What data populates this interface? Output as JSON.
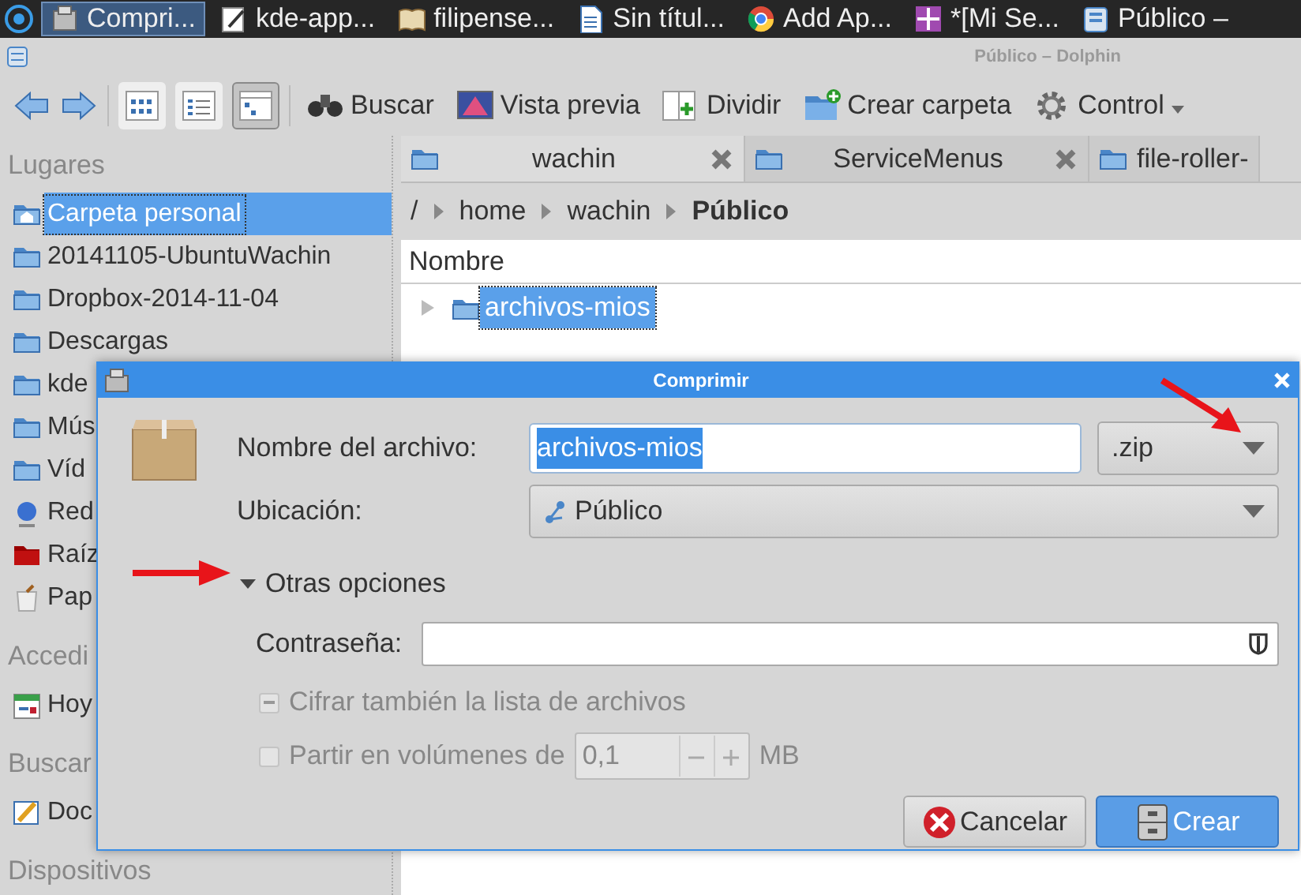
{
  "taskbar": {
    "items": [
      {
        "label": "Compri...",
        "kind": "archive",
        "selected": true
      },
      {
        "label": "kde-app...",
        "kind": "edit",
        "selected": false
      },
      {
        "label": "filipense...",
        "kind": "book",
        "selected": false
      },
      {
        "label": "Sin títul...",
        "kind": "document",
        "selected": false
      },
      {
        "label": "Add  Ap...",
        "kind": "browser",
        "selected": false
      },
      {
        "label": "*[Mi Se...",
        "kind": "image",
        "selected": false
      },
      {
        "label": "Público –",
        "kind": "files",
        "selected": false
      }
    ]
  },
  "window": {
    "title": "Público – Dolphin"
  },
  "toolbar": {
    "view_modes": [
      {
        "kind": "icons",
        "selected": false
      },
      {
        "kind": "compact",
        "selected": false
      },
      {
        "kind": "details",
        "selected": true
      }
    ],
    "actions": [
      {
        "label": "Buscar",
        "kind": "binoculars",
        "menu": false
      },
      {
        "label": "Vista previa",
        "kind": "preview",
        "menu": false
      },
      {
        "label": "Dividir",
        "kind": "split",
        "menu": false
      },
      {
        "label": "Crear carpeta",
        "kind": "newfolder",
        "menu": false
      },
      {
        "label": "Control",
        "kind": "gear",
        "menu": true
      }
    ]
  },
  "sidebar": {
    "sections": [
      {
        "title": "Lugares",
        "items": [
          {
            "label": "Carpeta personal",
            "kind": "home",
            "selected": true
          },
          {
            "label": "20141105-UbuntuWachin",
            "kind": "folder",
            "selected": false
          },
          {
            "label": "Dropbox-2014-11-04",
            "kind": "folder",
            "selected": false
          },
          {
            "label": "Descargas",
            "kind": "folder",
            "selected": false
          },
          {
            "label": "kde",
            "kind": "folder",
            "selected": false
          },
          {
            "label": "Mús",
            "kind": "folder",
            "selected": false
          },
          {
            "label": "Víd",
            "kind": "folder",
            "selected": false
          },
          {
            "label": "Red",
            "kind": "network",
            "selected": false
          },
          {
            "label": "Raíz",
            "kind": "root",
            "selected": false
          },
          {
            "label": "Pap",
            "kind": "trash",
            "selected": false
          }
        ]
      },
      {
        "title": "Accedi",
        "items": [
          {
            "label": "Hoy",
            "kind": "calendar",
            "selected": false
          }
        ]
      },
      {
        "title": "Buscar",
        "items": [
          {
            "label": "Doc",
            "kind": "document",
            "selected": false
          }
        ]
      },
      {
        "title": "Dispositivos"
      }
    ]
  },
  "tabs": [
    {
      "label": "wachin",
      "selected": true
    },
    {
      "label": "ServiceMenus",
      "selected": false
    },
    {
      "label": "file-roller-",
      "selected": false
    }
  ],
  "breadcrumb": [
    {
      "label": "/",
      "current": false
    },
    {
      "label": "home",
      "current": false
    },
    {
      "label": "wachin",
      "current": false
    },
    {
      "label": "Público",
      "current": true
    }
  ],
  "file_view": {
    "columns": [
      "Nombre"
    ],
    "rows": [
      {
        "name": "archivos-mios",
        "selected": true,
        "expanded": false
      }
    ]
  },
  "dialog": {
    "title": "Comprimir",
    "filename": {
      "label": "Nombre del archivo:",
      "value": "archivos-mios",
      "text_selected": true
    },
    "format": ".zip",
    "location": {
      "label": "Ubicación:",
      "value": "Público"
    },
    "more_options": {
      "label": "Otras opciones",
      "expanded": true
    },
    "password": {
      "label": "Contraseña:"
    },
    "encrypt_list": {
      "label": "Cifrar también la lista de archivos",
      "indeterminate": true,
      "disabled": true
    },
    "split": {
      "label": "Partir en volúmenes de",
      "checked": false,
      "disabled": true,
      "value": "0,1",
      "unit": "MB"
    },
    "buttons": [
      {
        "label": "Cancelar",
        "kind": "cancel",
        "default": false
      },
      {
        "label": "Crear",
        "kind": "create",
        "default": true
      }
    ]
  }
}
